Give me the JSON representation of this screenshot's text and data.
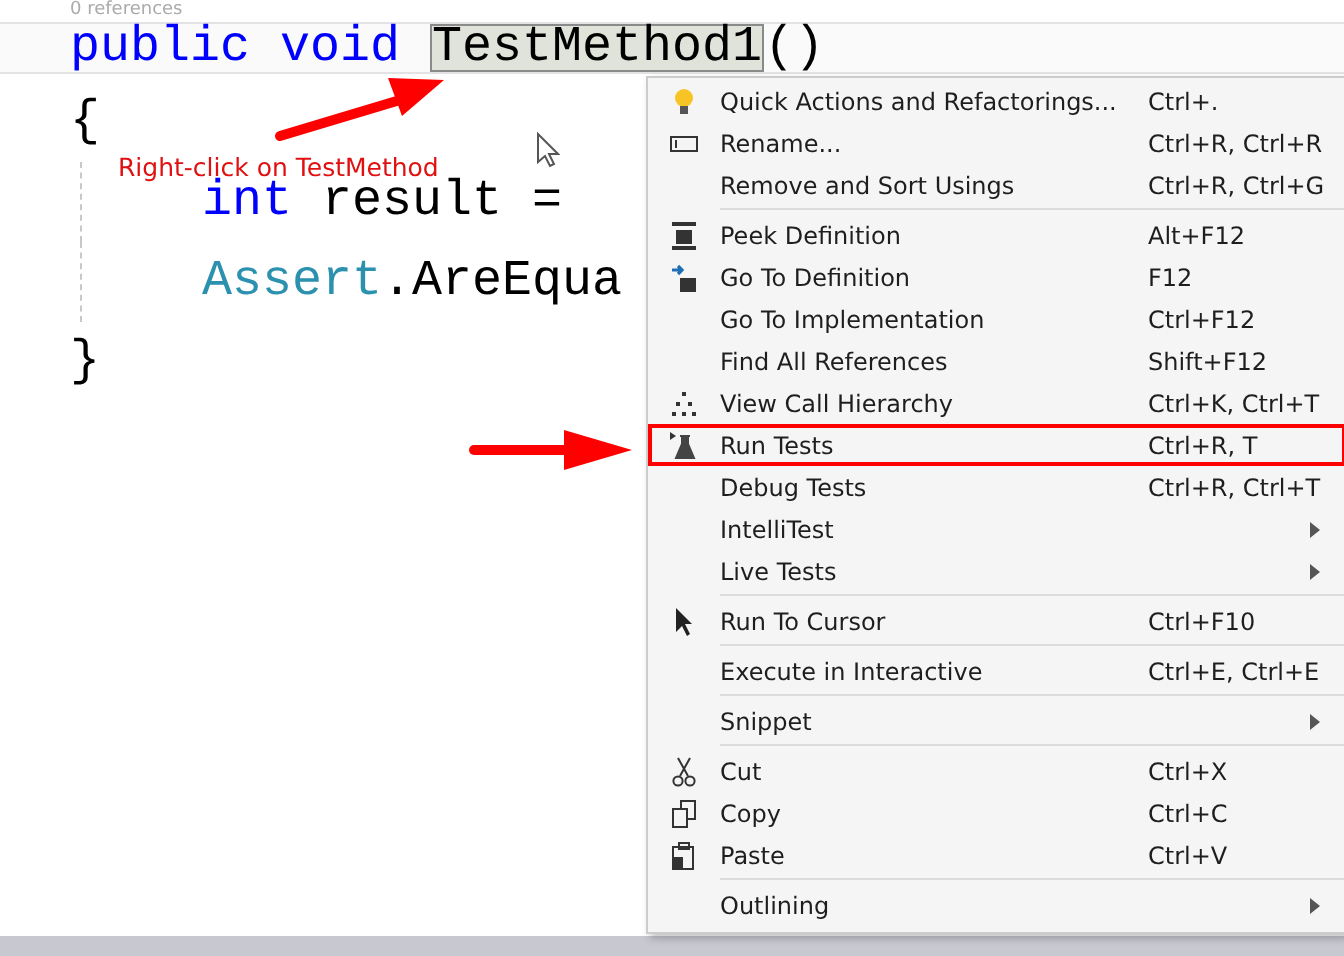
{
  "editor": {
    "codelens": "0 references",
    "lines": [
      {
        "kind": "signature",
        "tokens": [
          {
            "text": "public void ",
            "kind": "keyword"
          },
          {
            "text": "TestMethod1",
            "kind": "symbol"
          },
          {
            "text": "()",
            "kind": "plain"
          }
        ]
      },
      {
        "kind": "brace",
        "tokens": [
          {
            "text": "{",
            "kind": "plain"
          }
        ]
      },
      {
        "kind": "statement",
        "tokens": [
          {
            "text": "int",
            "kind": "keyword"
          },
          {
            "text": " result =",
            "kind": "plain"
          }
        ]
      },
      {
        "kind": "statement",
        "tokens": [
          {
            "text": "Assert",
            "kind": "type"
          },
          {
            "text": ".AreEqua",
            "kind": "plain"
          }
        ]
      },
      {
        "kind": "brace",
        "tokens": [
          {
            "text": "}",
            "kind": "plain"
          }
        ]
      }
    ]
  },
  "annotation": {
    "label": "Right-click on TestMethod"
  },
  "context_menu": {
    "items": [
      {
        "label": "Quick Actions and Refactorings...",
        "shortcut": "Ctrl+.",
        "separator_before": false,
        "has_submenu": false,
        "annotated": false
      },
      {
        "label": "Rename...",
        "shortcut": "Ctrl+R, Ctrl+R",
        "separator_before": false,
        "has_submenu": false,
        "annotated": false
      },
      {
        "label": "Remove and Sort Usings",
        "shortcut": "Ctrl+R, Ctrl+G",
        "separator_before": false,
        "has_submenu": false,
        "annotated": false
      },
      {
        "label": "Peek Definition",
        "shortcut": "Alt+F12",
        "separator_before": true,
        "has_submenu": false,
        "annotated": false
      },
      {
        "label": "Go To Definition",
        "shortcut": "F12",
        "separator_before": false,
        "has_submenu": false,
        "annotated": false
      },
      {
        "label": "Go To Implementation",
        "shortcut": "Ctrl+F12",
        "separator_before": false,
        "has_submenu": false,
        "annotated": false
      },
      {
        "label": "Find All References",
        "shortcut": "Shift+F12",
        "separator_before": false,
        "has_submenu": false,
        "annotated": false
      },
      {
        "label": "View Call Hierarchy",
        "shortcut": "Ctrl+K, Ctrl+T",
        "separator_before": false,
        "has_submenu": false,
        "annotated": false
      },
      {
        "label": "Run Tests",
        "shortcut": "Ctrl+R, T",
        "separator_before": false,
        "has_submenu": false,
        "annotated": true
      },
      {
        "label": "Debug Tests",
        "shortcut": "Ctrl+R, Ctrl+T",
        "separator_before": false,
        "has_submenu": false,
        "annotated": false
      },
      {
        "label": "IntelliTest",
        "separator_before": false,
        "has_submenu": true,
        "annotated": false
      },
      {
        "label": "Live Tests",
        "separator_before": false,
        "has_submenu": true,
        "annotated": false
      },
      {
        "label": "Run To Cursor",
        "shortcut": "Ctrl+F10",
        "separator_before": true,
        "has_submenu": false,
        "annotated": false
      },
      {
        "label": "Execute in Interactive",
        "shortcut": "Ctrl+E, Ctrl+E",
        "separator_before": true,
        "has_submenu": false,
        "annotated": false
      },
      {
        "label": "Snippet",
        "separator_before": true,
        "has_submenu": true,
        "annotated": false
      },
      {
        "label": "Cut",
        "shortcut": "Ctrl+X",
        "separator_before": true,
        "has_submenu": false,
        "annotated": false
      },
      {
        "label": "Copy",
        "shortcut": "Ctrl+C",
        "separator_before": false,
        "has_submenu": false,
        "annotated": false
      },
      {
        "label": "Paste",
        "shortcut": "Ctrl+V",
        "separator_before": false,
        "has_submenu": false,
        "annotated": false
      },
      {
        "label": "Outlining",
        "separator_before": true,
        "has_submenu": true,
        "annotated": false
      }
    ]
  }
}
